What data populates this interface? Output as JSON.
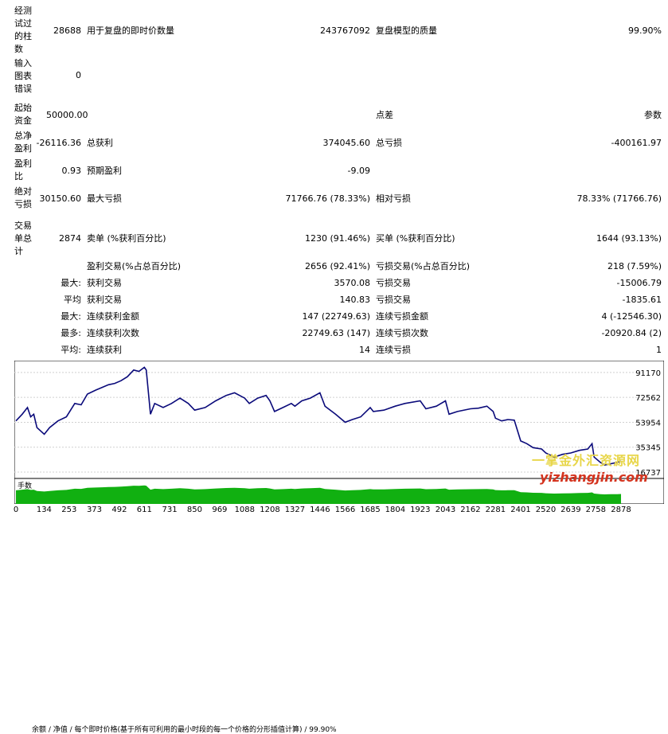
{
  "stats": {
    "bars_tested": {
      "label": "经测试过的柱数",
      "value": "28688"
    },
    "ticks": {
      "label": "用于复盘的即时价数量",
      "value": "243767092"
    },
    "quality": {
      "label": "复盘模型的质量",
      "value": "99.90%"
    },
    "chart_errors": {
      "label": "输入图表错误",
      "value": "0"
    },
    "initial_deposit": {
      "label": "起始资金",
      "value": "50000.00"
    },
    "spread": {
      "label": "点差",
      "value": "参数"
    },
    "net_profit": {
      "label": "总净盈利",
      "value": "-26116.36"
    },
    "gross_profit": {
      "label": "总获利",
      "value": "374045.60"
    },
    "gross_loss": {
      "label": "总亏损",
      "value": "-400161.97"
    },
    "profit_factor": {
      "label": "盈利比",
      "value": "0.93"
    },
    "expected_payoff": {
      "label": "预期盈利",
      "value": "-9.09"
    },
    "abs_drawdown": {
      "label": "绝对亏损",
      "value": "30150.60"
    },
    "max_drawdown": {
      "label": "最大亏损",
      "value": "71766.76 (78.33%)"
    },
    "rel_drawdown": {
      "label": "相对亏损",
      "value": "78.33% (71766.76)"
    },
    "total_trades": {
      "label": "交易单总计",
      "value": "2874"
    },
    "short_positions": {
      "label": "卖单 (%获利百分比)",
      "value": "1230 (91.46%)"
    },
    "long_positions": {
      "label": "买单 (%获利百分比)",
      "value": "1644 (93.13%)"
    },
    "profit_trades": {
      "label": "盈利交易(%占总百分比)",
      "value": "2656 (92.41%)"
    },
    "loss_trades": {
      "label": "亏损交易(%占总百分比)",
      "value": "218 (7.59%)"
    },
    "largest_label": "最大:",
    "largest_profit": {
      "label": "获利交易",
      "value": "3570.08"
    },
    "largest_loss": {
      "label": "亏损交易",
      "value": "-15006.79"
    },
    "average_label": "平均",
    "average_profit": {
      "label": "获利交易",
      "value": "140.83"
    },
    "average_loss": {
      "label": "亏损交易",
      "value": "-1835.61"
    },
    "max_label": "最大:",
    "max_consec_wins": {
      "label": "连续获利金额",
      "value": "147 (22749.63)"
    },
    "max_consec_losses": {
      "label": "连续亏损金额",
      "value": "4 (-12546.30)"
    },
    "maximal_label": "最多:",
    "maximal_consec_profit": {
      "label": "连续获利次数",
      "value": "22749.63 (147)"
    },
    "maximal_consec_loss": {
      "label": "连续亏损次数",
      "value": "-20920.84 (2)"
    },
    "avg_label": "平均:",
    "avg_consec_wins": {
      "label": "连续获利",
      "value": "14"
    },
    "avg_consec_losses": {
      "label": "连续亏损",
      "value": "1"
    }
  },
  "chart_data": {
    "type": "line",
    "legend": "余额 / 净值 / 每个即时价格(基于所有可利用的最小时段的每一个价格的分形插值计算) / 99.90%",
    "legend_colors": {
      "balance": "#0000a0",
      "equity": "#00b000"
    },
    "ylim": [
      12000,
      100000
    ],
    "y_ticks": [
      "91170",
      "72562",
      "53954",
      "35345",
      "16737"
    ],
    "x_ticks": [
      "0",
      "134",
      "253",
      "373",
      "492",
      "611",
      "731",
      "850",
      "969",
      "1088",
      "1208",
      "1327",
      "1446",
      "1566",
      "1685",
      "1804",
      "1923",
      "2043",
      "2162",
      "2281",
      "2401",
      "2520",
      "2639",
      "2758",
      "2878"
    ],
    "x_range": [
      0,
      2878
    ],
    "series": [
      {
        "values": [
          [
            0,
            55000
          ],
          [
            30,
            60000
          ],
          [
            55,
            65000
          ],
          [
            70,
            58000
          ],
          [
            85,
            60000
          ],
          [
            100,
            50000
          ],
          [
            135,
            45000
          ],
          [
            160,
            50000
          ],
          [
            200,
            55000
          ],
          [
            240,
            58000
          ],
          [
            280,
            68000
          ],
          [
            310,
            67000
          ],
          [
            340,
            75000
          ],
          [
            380,
            78000
          ],
          [
            410,
            80000
          ],
          [
            440,
            82000
          ],
          [
            470,
            83000
          ],
          [
            500,
            85000
          ],
          [
            530,
            88000
          ],
          [
            560,
            93000
          ],
          [
            585,
            92000
          ],
          [
            611,
            95000
          ],
          [
            620,
            93000
          ],
          [
            640,
            60000
          ],
          [
            660,
            68000
          ],
          [
            700,
            65000
          ],
          [
            740,
            68000
          ],
          [
            780,
            72000
          ],
          [
            820,
            68000
          ],
          [
            850,
            63000
          ],
          [
            900,
            65000
          ],
          [
            950,
            70000
          ],
          [
            1000,
            74000
          ],
          [
            1040,
            76000
          ],
          [
            1088,
            72000
          ],
          [
            1110,
            68000
          ],
          [
            1150,
            72000
          ],
          [
            1190,
            74000
          ],
          [
            1208,
            70000
          ],
          [
            1230,
            62000
          ],
          [
            1270,
            65000
          ],
          [
            1310,
            68000
          ],
          [
            1327,
            66000
          ],
          [
            1360,
            70000
          ],
          [
            1400,
            72000
          ],
          [
            1446,
            76000
          ],
          [
            1470,
            66000
          ],
          [
            1520,
            60000
          ],
          [
            1566,
            54000
          ],
          [
            1600,
            56000
          ],
          [
            1640,
            58000
          ],
          [
            1685,
            65000
          ],
          [
            1700,
            62000
          ],
          [
            1750,
            63000
          ],
          [
            1804,
            66000
          ],
          [
            1850,
            68000
          ],
          [
            1923,
            70000
          ],
          [
            1950,
            64000
          ],
          [
            2000,
            66000
          ],
          [
            2043,
            70000
          ],
          [
            2060,
            60000
          ],
          [
            2100,
            62000
          ],
          [
            2162,
            64000
          ],
          [
            2200,
            64500
          ],
          [
            2240,
            66000
          ],
          [
            2270,
            62000
          ],
          [
            2281,
            57000
          ],
          [
            2310,
            55000
          ],
          [
            2340,
            56000
          ],
          [
            2370,
            55500
          ],
          [
            2401,
            40000
          ],
          [
            2430,
            38000
          ],
          [
            2460,
            35000
          ],
          [
            2500,
            34000
          ],
          [
            2520,
            31000
          ],
          [
            2560,
            28000
          ],
          [
            2600,
            30000
          ],
          [
            2639,
            31000
          ],
          [
            2680,
            33000
          ],
          [
            2720,
            34000
          ],
          [
            2740,
            38000
          ],
          [
            2750,
            28000
          ],
          [
            2780,
            24000
          ],
          [
            2800,
            22000
          ],
          [
            2830,
            23000
          ],
          [
            2860,
            24000
          ],
          [
            2878,
            25000
          ]
        ]
      }
    ],
    "volume_label": "手数"
  },
  "watermark": {
    "line1": "一掌金外汇资源网",
    "line2": "yizhangjin.com"
  }
}
